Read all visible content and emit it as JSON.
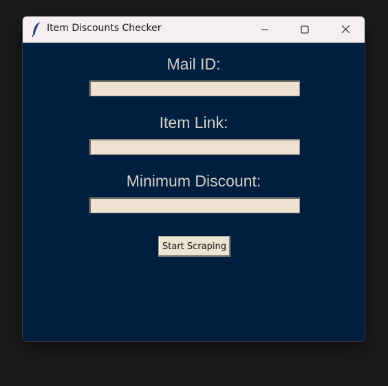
{
  "window": {
    "title": "Item Discounts Checker",
    "icon": "feather-icon"
  },
  "form": {
    "mail_label": "Mail ID:",
    "mail_value": "",
    "link_label": "Item Link:",
    "link_value": "",
    "discount_label": "Minimum Discount:",
    "discount_value": "",
    "start_button_label": "Start Scraping"
  },
  "colors": {
    "background": "#001f3f",
    "label_text": "#d7d0c8",
    "entry_background": "#eee3d2",
    "titlebar": "#f4eff1"
  }
}
